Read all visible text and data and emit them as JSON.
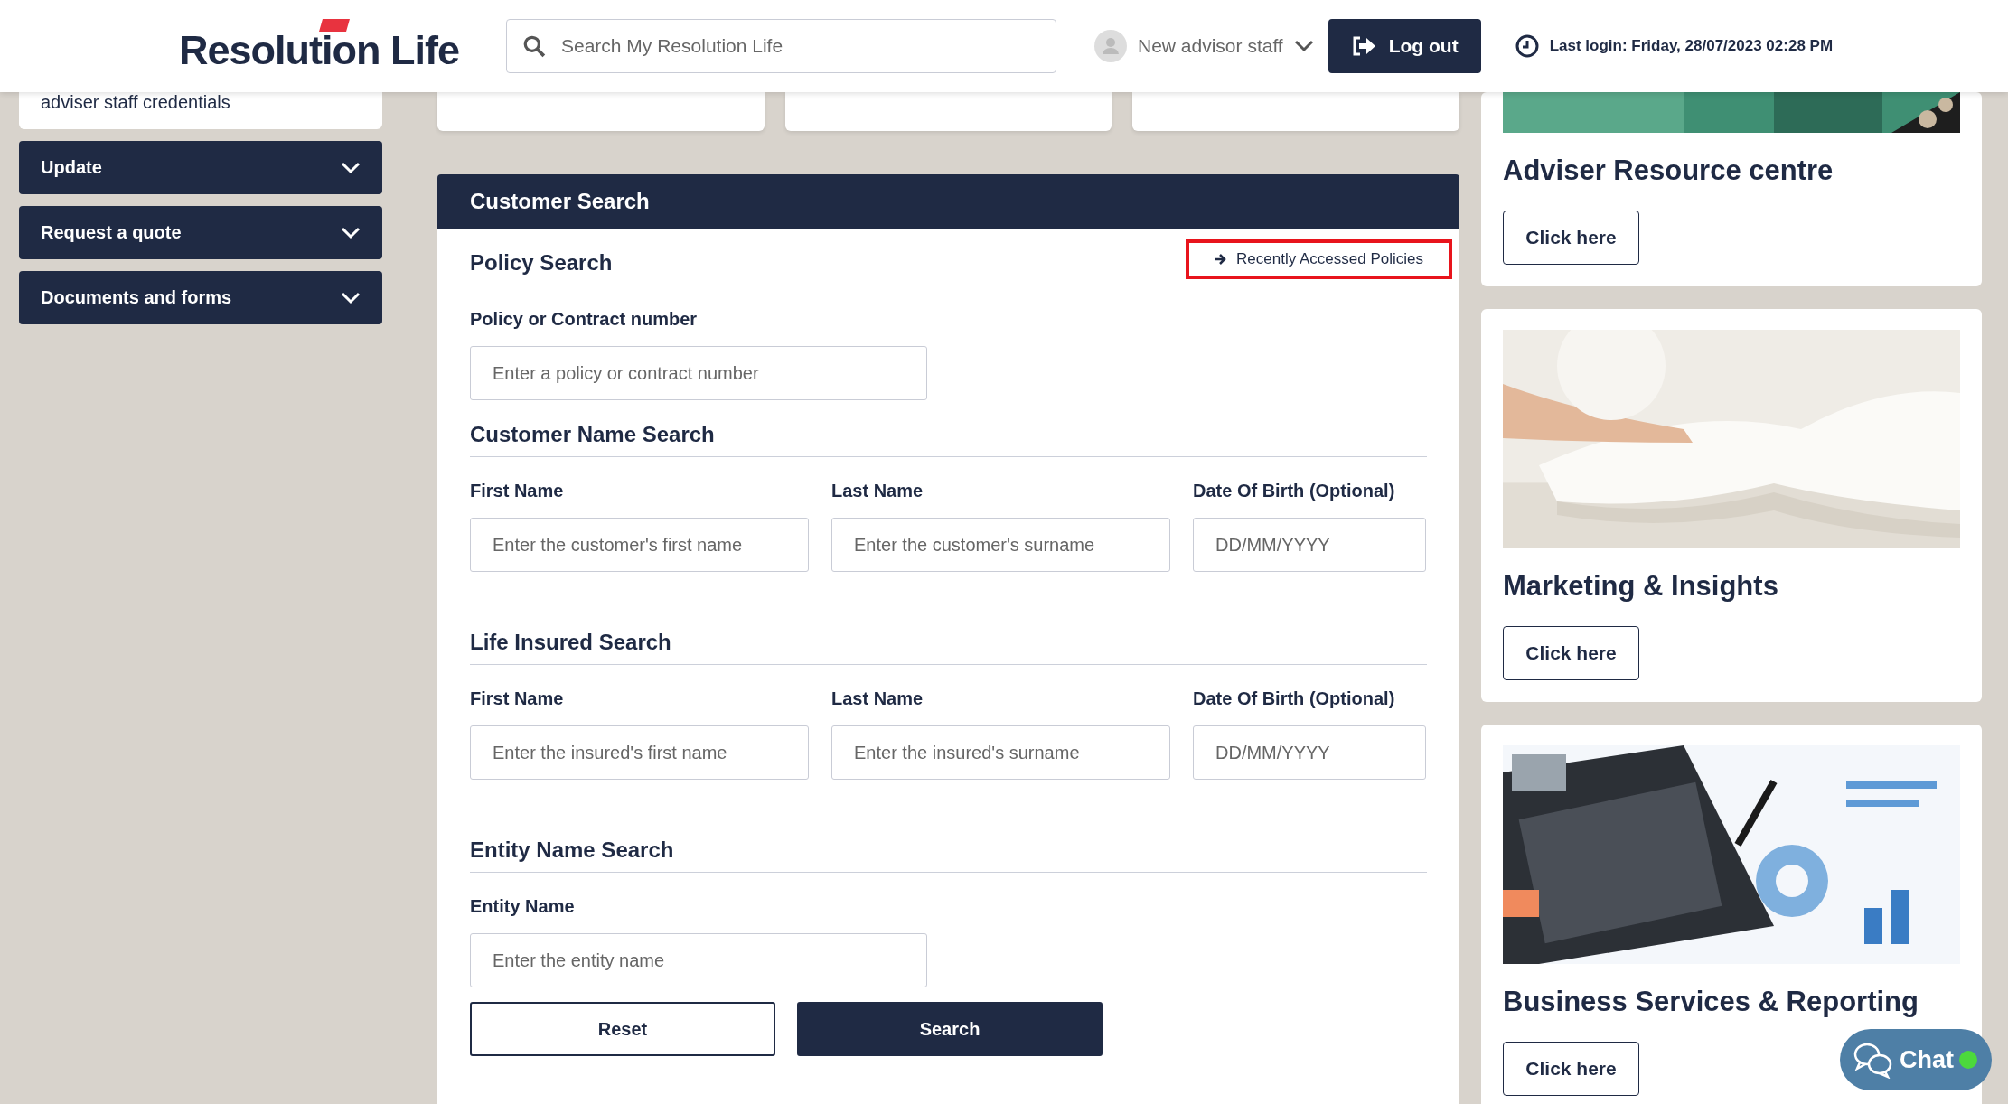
{
  "header": {
    "logo": "Resolution Life",
    "search": {
      "placeholder": "Search My Resolution Life"
    },
    "user": "New advisor staff",
    "logout": "Log out",
    "last_login": "Last login: Friday, 28/07/2023 02:28 PM"
  },
  "sidebar": {
    "card_text": "adviser staff credentials",
    "items": [
      {
        "label": "Update",
        "expanded": false
      },
      {
        "label": "Request a quote",
        "expanded": false
      },
      {
        "label": "Documents and forms",
        "expanded": false
      }
    ]
  },
  "customer_search": {
    "title": "Customer Search",
    "recent_link": {
      "label": "Recently Accessed Policies",
      "highlighted": true
    },
    "sections": [
      {
        "title": "Policy Search",
        "fields": [
          {
            "label": "Policy or Contract number",
            "placeholder": "Enter a policy or contract number"
          }
        ]
      },
      {
        "title": "Customer Name Search",
        "fields": [
          {
            "label": "First Name",
            "placeholder": "Enter the customer's first name"
          },
          {
            "label": "Last Name",
            "placeholder": "Enter the customer's surname"
          },
          {
            "label": "Date Of Birth (Optional)",
            "placeholder": "DD/MM/YYYY"
          }
        ]
      },
      {
        "title": "Life Insured Search",
        "fields": [
          {
            "label": "First Name",
            "placeholder": "Enter the insured's first name"
          },
          {
            "label": "Last Name",
            "placeholder": "Enter the insured's surname"
          },
          {
            "label": "Date Of Birth (Optional)",
            "placeholder": "DD/MM/YYYY"
          }
        ]
      },
      {
        "title": "Entity Name Search",
        "fields": [
          {
            "label": "Entity Name",
            "placeholder": "Enter the entity name"
          }
        ]
      }
    ],
    "buttons": [
      {
        "label": "Reset",
        "kind": "secondary"
      },
      {
        "label": "Search",
        "kind": "primary"
      }
    ]
  },
  "resources": [
    {
      "title": "Adviser Resource centre",
      "button": "Click here",
      "kind": "picture"
    },
    {
      "title": "Marketing & Insights",
      "button": "Click here",
      "kind": "picture"
    },
    {
      "title": "Business Services & Reporting",
      "button": "Click here",
      "kind": "picture"
    }
  ],
  "chat": {
    "label": "Chat",
    "online": true
  }
}
